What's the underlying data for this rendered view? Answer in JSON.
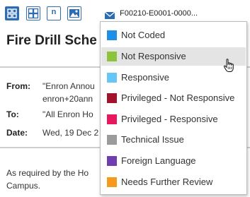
{
  "toolbar": {
    "document_id": "F00210-E0001-0000...",
    "buttons": [
      {
        "icon": "single-view-icon",
        "active": true
      },
      {
        "icon": "grid-view-icon",
        "active": false
      },
      {
        "icon": "native-text-icon",
        "label": "n",
        "active": false
      },
      {
        "icon": "image-view-icon",
        "active": false
      }
    ],
    "accent_color": "#2d6cb5"
  },
  "email": {
    "subject": "Fire Drill Sche",
    "from_label": "From:",
    "from_line1": "\"Enron Annou",
    "from_line2": "enron+20ann",
    "to_label": "To:",
    "to_value": "\"All Enron Ho",
    "date_label": "Date:",
    "date_value": "Wed, 19 Dec 2",
    "body_line1": "As required by the Ho",
    "body_line2": "Campus."
  },
  "coding_menu": {
    "items": [
      {
        "label": "Not Coded",
        "color": "#1e8fe6"
      },
      {
        "label": "Not Responsive",
        "color": "#8cc43c",
        "hovered": true
      },
      {
        "label": "Responsive",
        "color": "#66c6f5"
      },
      {
        "label": "Privileged - Not Responsive",
        "color": "#a3122b"
      },
      {
        "label": "Privileged - Responsive",
        "color": "#e8185f"
      },
      {
        "label": "Technical Issue",
        "color": "#9b9b9b"
      },
      {
        "label": "Foreign Language",
        "color": "#6f3db0"
      },
      {
        "label": "Needs Further Review",
        "color": "#f59a1c"
      }
    ]
  }
}
